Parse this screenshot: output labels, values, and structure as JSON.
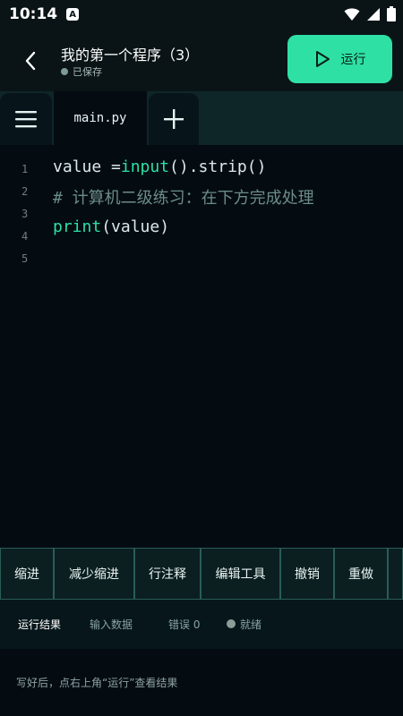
{
  "status_bar": {
    "time": "10:14",
    "badge_letter": "A",
    "icons": [
      "wifi-icon",
      "signal-icon",
      "battery-icon"
    ]
  },
  "header": {
    "back_icon": "chevron-left-icon",
    "title": "我的第一个程序（3）",
    "saved_status": "已保存",
    "run_label": "运行",
    "run_icon": "play-icon"
  },
  "tabs": {
    "menu_icon": "menu-icon",
    "active_file": "main.py",
    "add_icon": "plus-icon"
  },
  "editor": {
    "lines": [
      {
        "num": "1",
        "tokens": [
          [
            "value = ",
            "plain"
          ],
          [
            "input",
            "fn"
          ],
          [
            "().strip()",
            "plain"
          ]
        ]
      },
      {
        "num": "2",
        "tokens": []
      },
      {
        "num": "3",
        "tokens": [
          [
            "# 计算机二级练习：在下方完成处理",
            "comment"
          ]
        ]
      },
      {
        "num": "4",
        "tokens": [
          [
            "print",
            "fn"
          ],
          [
            "(value)",
            "plain"
          ]
        ]
      },
      {
        "num": "5",
        "tokens": []
      }
    ]
  },
  "toolbar": {
    "items": [
      "缩进",
      "减少缩进",
      "行注释",
      "编辑工具",
      "撤销",
      "重做"
    ]
  },
  "result": {
    "tabs": [
      "运行结果",
      "输入数据",
      "错误 0"
    ],
    "status": "就绪",
    "hint": "写好后，点右上角“运行”查看结果"
  },
  "colors": {
    "accent": "#2ee0a4",
    "background": "#040c12",
    "panel": "#0f2628"
  }
}
